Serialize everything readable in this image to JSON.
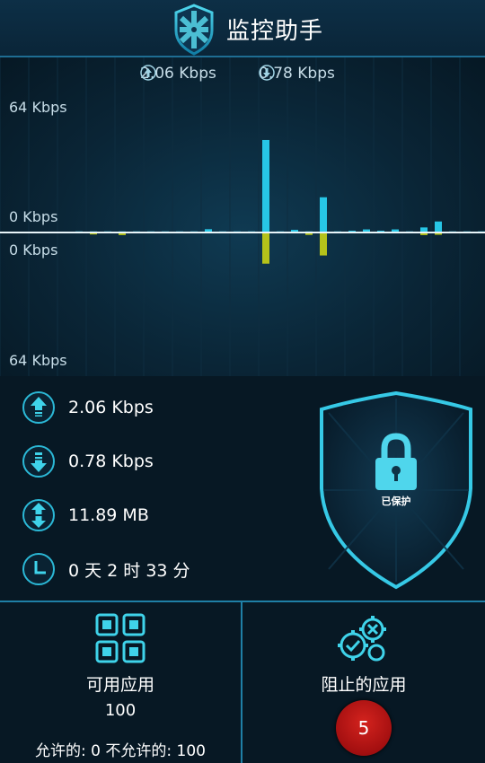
{
  "header": {
    "title": "监控助手",
    "logo_icon": "shield-logo-icon"
  },
  "chart_data": {
    "type": "bar",
    "unit": "Kbps",
    "top_rates": {
      "upload": "2.06 Kbps",
      "download": "0.78 Kbps"
    },
    "axis_labels": {
      "upload_max": "64 Kbps",
      "upload_zero": "0 Kbps",
      "download_zero": "0 Kbps",
      "download_max": "64 Kbps"
    },
    "ylim": [
      0,
      64
    ],
    "upload": [
      0.5,
      0.5,
      0.5,
      0.5,
      0.5,
      0.5,
      0.5,
      0.5,
      0.5,
      1.5,
      0.5,
      0.5,
      0.5,
      42,
      0.5,
      1.2,
      0.5,
      16,
      0.5,
      0.8,
      1.4,
      0.8,
      1.4,
      0.5,
      2.3,
      5.0,
      0.5,
      0.5,
      0.5,
      0.5,
      0.5,
      1.3
    ],
    "download": [
      0.5,
      1.2,
      0.5,
      1.6,
      0.5,
      0.5,
      0.5,
      0.5,
      0.5,
      0.5,
      0.5,
      0.5,
      0.5,
      19,
      0.5,
      0.5,
      1.5,
      14,
      0.5,
      0.5,
      0.5,
      0.5,
      0.5,
      0.5,
      1.6,
      1.4,
      0.5,
      0.5,
      0.5,
      1.4,
      0.5,
      0.5
    ]
  },
  "stats": {
    "upload": "2.06 Kbps",
    "download": "0.78 Kbps",
    "total": "11.89 MB",
    "uptime": "0 天 2 时 33 分"
  },
  "protection": {
    "status": "已保护"
  },
  "panels": {
    "allowed": {
      "title": "可用应用",
      "count": "100",
      "sub": "允许的: 0 不允许的: 100"
    },
    "blocked": {
      "title": "阻止的应用",
      "count": "5"
    }
  },
  "colors": {
    "accent": "#2fd2e8",
    "upload_bar": "#27c6e6",
    "download_bar": "#b4c21a",
    "badge": "#b41416"
  }
}
